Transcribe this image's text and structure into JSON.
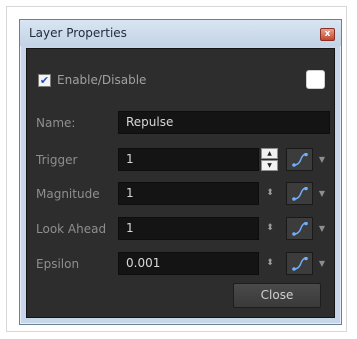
{
  "window": {
    "title": "Layer Properties",
    "close_glyph": "x"
  },
  "enable": {
    "label": "Enable/Disable",
    "checked": true,
    "check_glyph": "✔"
  },
  "fields": [
    {
      "label": "Name:",
      "value": "Repulse"
    },
    {
      "label": "Trigger",
      "value": "1"
    },
    {
      "label": "Magnitude",
      "value": "1"
    },
    {
      "label": "Look Ahead",
      "value": "1"
    },
    {
      "label": "Epsilon",
      "value": "0.001"
    }
  ],
  "icons": {
    "spin_up": "▲",
    "spin_down": "▼",
    "spin_small": "⬍",
    "dropdown": "▼",
    "function": "function-curve-icon"
  },
  "buttons": {
    "close_label": "Close"
  },
  "colors": {
    "panel_bg": "#2d2d2d",
    "field_bg": "#141414",
    "titlebar": "#c7d6e8",
    "close_red": "#c5452e"
  }
}
